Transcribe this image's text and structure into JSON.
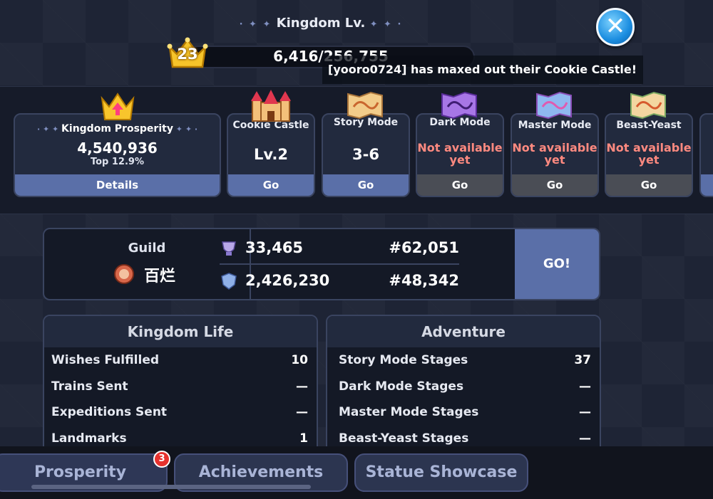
{
  "header": {
    "title": "Kingdom Lv.",
    "level": "23",
    "exp": "6,416/256,755",
    "notification": "[yooro0724] has maxed out their Cookie Castle!"
  },
  "cards": {
    "prosperity": {
      "label": "Kingdom Prosperity",
      "value": "4,540,936",
      "sub": "Top 12.9%",
      "button": "Details"
    },
    "castle": {
      "label": "Cookie Castle",
      "value": "Lv.2",
      "button": "Go"
    },
    "story": {
      "label": "Story Mode",
      "value": "3-6",
      "button": "Go"
    },
    "dark": {
      "label": "Dark Mode",
      "value": "Not available yet",
      "button": "Go"
    },
    "master": {
      "label": "Master Mode",
      "value": "Not available yet",
      "button": "Go"
    },
    "beast": {
      "label": "Beast-Yeast",
      "value": "Not available yet",
      "button": "Go"
    }
  },
  "guild": {
    "label": "Guild",
    "name": "百烂",
    "stat1_value": "33,465",
    "stat1_rank": "#62,051",
    "stat2_value": "2,426,230",
    "stat2_rank": "#48,342",
    "go_label": "GO!"
  },
  "kingdom_life": {
    "title": "Kingdom Life",
    "rows": [
      {
        "label": "Wishes Fulfilled",
        "value": "10"
      },
      {
        "label": "Trains Sent",
        "value": "—"
      },
      {
        "label": "Expeditions Sent",
        "value": "—"
      },
      {
        "label": "Landmarks",
        "value": "1"
      }
    ]
  },
  "adventure": {
    "title": "Adventure",
    "rows": [
      {
        "label": "Story Mode Stages",
        "value": "37"
      },
      {
        "label": "Dark Mode Stages",
        "value": "—"
      },
      {
        "label": "Master Mode Stages",
        "value": "—"
      },
      {
        "label": "Beast-Yeast Stages",
        "value": "—"
      }
    ]
  },
  "tabs": {
    "prosperity": "Prosperity",
    "prosperity_badge": "3",
    "achievements": "Achievements",
    "statue": "Statue Showcase"
  },
  "colors": {
    "accent_blue": "#5a6fa8",
    "not_available": "#ff8a80",
    "badge": "#e6322e"
  }
}
